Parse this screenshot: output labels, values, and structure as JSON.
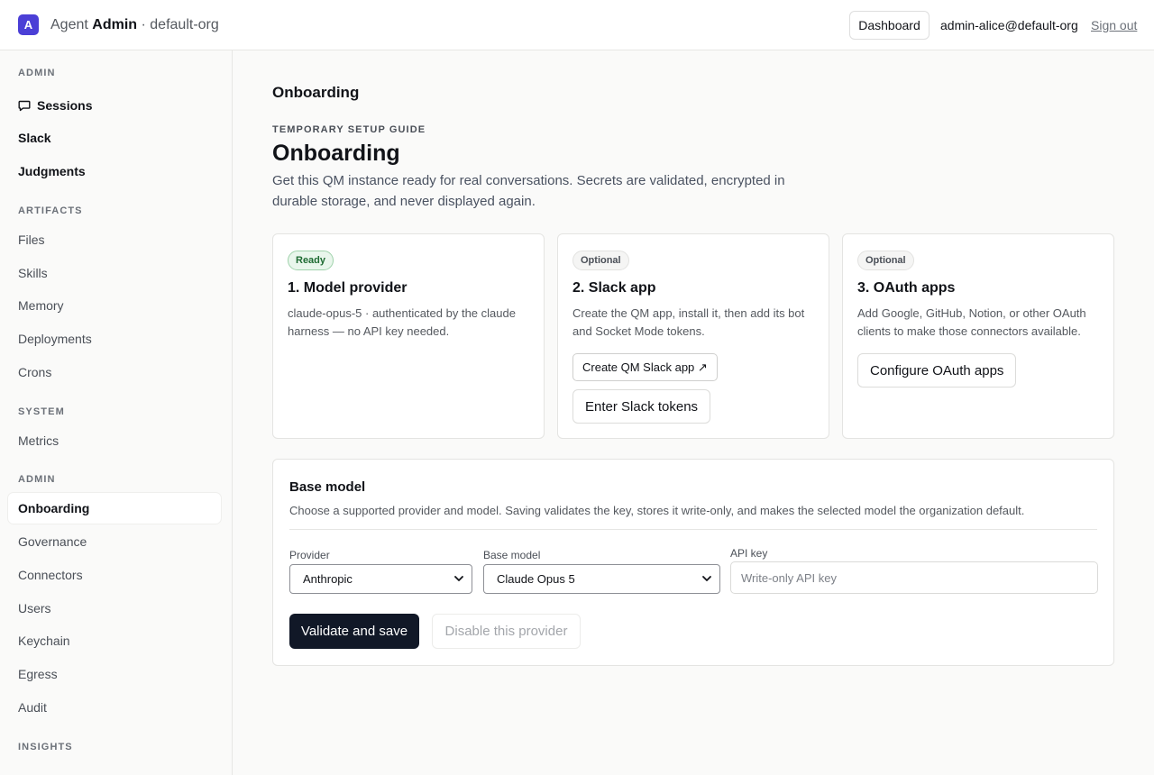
{
  "header": {
    "logo_letter": "A",
    "brand_prefix": "Agent",
    "brand_name": "Admin",
    "org_suffix": "· default-org",
    "dashboard_label": "Dashboard",
    "user_email": "admin-alice@default-org",
    "signout_label": "Sign out"
  },
  "sidebar": {
    "sections": [
      {
        "label": "ADMIN",
        "items": [
          {
            "label": "Sessions",
            "icon": "chat-bubble-icon"
          },
          {
            "label": "Slack"
          },
          {
            "label": "Judgments"
          }
        ]
      },
      {
        "label": "ARTIFACTS",
        "items": [
          {
            "label": "Files"
          },
          {
            "label": "Skills"
          },
          {
            "label": "Memory"
          },
          {
            "label": "Deployments"
          },
          {
            "label": "Crons"
          }
        ]
      },
      {
        "label": "SYSTEM",
        "items": [
          {
            "label": "Metrics"
          }
        ]
      },
      {
        "label": "ADMIN",
        "items": [
          {
            "label": "Onboarding",
            "active": true
          },
          {
            "label": "Governance"
          },
          {
            "label": "Connectors"
          },
          {
            "label": "Users"
          },
          {
            "label": "Keychain"
          },
          {
            "label": "Egress"
          },
          {
            "label": "Audit"
          }
        ]
      },
      {
        "label": "INSIGHTS",
        "items": []
      }
    ]
  },
  "main": {
    "page_title": "Onboarding",
    "eyebrow": "TEMPORARY SETUP GUIDE",
    "heading": "Onboarding",
    "lede": "Get this QM instance ready for real conversations. Secrets are validated, encrypted in durable storage, and never displayed again.",
    "cards": [
      {
        "badge": "Ready",
        "title": "1. Model provider",
        "desc": "claude-opus-5 · authenticated by the claude harness — no API key needed."
      },
      {
        "badge": "Optional",
        "title": "2. Slack app",
        "desc": "Create the QM app, install it, then add its bot and Socket Mode tokens.",
        "create_button": "Create QM Slack app ↗",
        "tokens_button": "Enter Slack tokens"
      },
      {
        "badge": "Optional",
        "title": "3. OAuth apps",
        "desc": "Add Google, GitHub, Notion, or other OAuth clients to make those connectors available.",
        "configure_button": "Configure OAuth apps"
      }
    ],
    "base_model": {
      "title": "Base model",
      "desc": "Choose a supported provider and model. Saving validates the key, stores it write-only, and makes the selected model the organization default.",
      "provider_label": "Provider",
      "provider_value": "Anthropic",
      "model_label": "Base model",
      "model_value": "Claude Opus 5",
      "api_key_label": "API key",
      "api_key_placeholder": "Write-only API key",
      "save_button": "Validate and save",
      "disable_button": "Disable this provider"
    }
  },
  "colors": {
    "accent": "#4b3fd6",
    "primary_button": "#111827",
    "ready_badge_bg": "#e9f6ec",
    "ready_badge_text": "#1f6b33"
  }
}
